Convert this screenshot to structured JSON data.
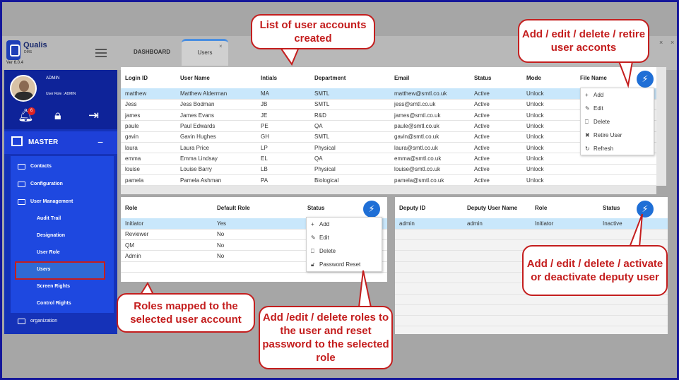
{
  "app": {
    "logo_title": "Qualis",
    "logo_sub": "DMS",
    "version": "Ver 6.0.4"
  },
  "tabs": {
    "dashboard": "DASHBOARD",
    "users": "Users",
    "close": "×"
  },
  "window": {
    "close_a": "×",
    "close_b": "×"
  },
  "profile": {
    "name": "ADMIN",
    "role": "User Role : ADMIN",
    "notification_count": "6"
  },
  "sidebar": {
    "master": "MASTER",
    "items": [
      {
        "label": "Contacts",
        "icon": "folder-icon"
      },
      {
        "label": "Configuration",
        "icon": "folder-icon"
      },
      {
        "label": "User Management",
        "icon": "folder-icon"
      }
    ],
    "sub_items": [
      "Audit Trail",
      "Designation",
      "User Role",
      "Users",
      "Screen Rights",
      "Control Rights"
    ],
    "organization": "organization"
  },
  "users_table": {
    "columns": [
      "Login ID",
      "User Name",
      "Intials",
      "Department",
      "Email",
      "Status",
      "Mode",
      "File Name"
    ],
    "rows": [
      [
        "matthew",
        "Matthew Alderman",
        "MA",
        "SMTL",
        "matthew@smtl.co.uk",
        "Active",
        "Unlock",
        ""
      ],
      [
        "Jess",
        "Jess Bodman",
        "JB",
        "SMTL",
        "jess@smtl.co.uk",
        "Active",
        "Unlock",
        ""
      ],
      [
        "james",
        "James Evans",
        "JE",
        "R&D",
        "james@smtl.co.uk",
        "Active",
        "Unlock",
        ""
      ],
      [
        "paule",
        "Paul Edwards",
        "PE",
        "QA",
        "paule@smtl.co.uk",
        "Active",
        "Unlock",
        ""
      ],
      [
        "gavin",
        "Gavin Hughes",
        "GH",
        "SMTL",
        "gavin@smtl.co.uk",
        "Active",
        "Unlock",
        ""
      ],
      [
        "laura",
        "Laura Price",
        "LP",
        "Physical",
        "laura@smtl.co.uk",
        "Active",
        "Unlock",
        ""
      ],
      [
        "emma",
        "Emma Lindsay",
        "EL",
        "QA",
        "emma@smtl.co.uk",
        "Active",
        "Unlock",
        ""
      ],
      [
        "louise",
        "Louise Barry",
        "LB",
        "Physical",
        "louise@smtl.co.uk",
        "Active",
        "Unlock",
        ""
      ],
      [
        "pamela",
        "Pamela Ashman",
        "PA",
        "Biological",
        "pamela@smtl.co.uk",
        "Active",
        "Unlock",
        ""
      ]
    ],
    "menu": [
      "Add",
      "Edit",
      "Delete",
      "Retire User",
      "Refresh"
    ]
  },
  "roles_table": {
    "columns": [
      "Role",
      "Default Role",
      "Status"
    ],
    "rows": [
      [
        "Initiator",
        "Yes",
        ""
      ],
      [
        "Reviewer",
        "No",
        ""
      ],
      [
        "QM",
        "No",
        ""
      ],
      [
        "Admin",
        "No",
        ""
      ]
    ],
    "menu": [
      "Add",
      "Edit",
      "Delete",
      "Password Reset"
    ]
  },
  "deputy_table": {
    "columns": [
      "Deputy ID",
      "Deputy User Name",
      "Role",
      "Status"
    ],
    "rows": [
      [
        "admin",
        "admin",
        "Initiator",
        "Inactive"
      ]
    ]
  },
  "callouts": {
    "list": "List of user accounts created",
    "users_actions": "Add / edit / delete / retire user acconts",
    "deputy_actions": "Add / edit / delete / activate or deactivate deputy user",
    "roles_mapped": "Roles mapped to the selected user account",
    "roles_actions": "Add /edit / delete roles to the user and reset  password to the selected role"
  },
  "colors": {
    "frame": "#15179a",
    "callout": "#c41e1e",
    "sidebar": "#1532b8",
    "selected_row": "#c9e7fb",
    "action_button": "#1f6fd6"
  }
}
